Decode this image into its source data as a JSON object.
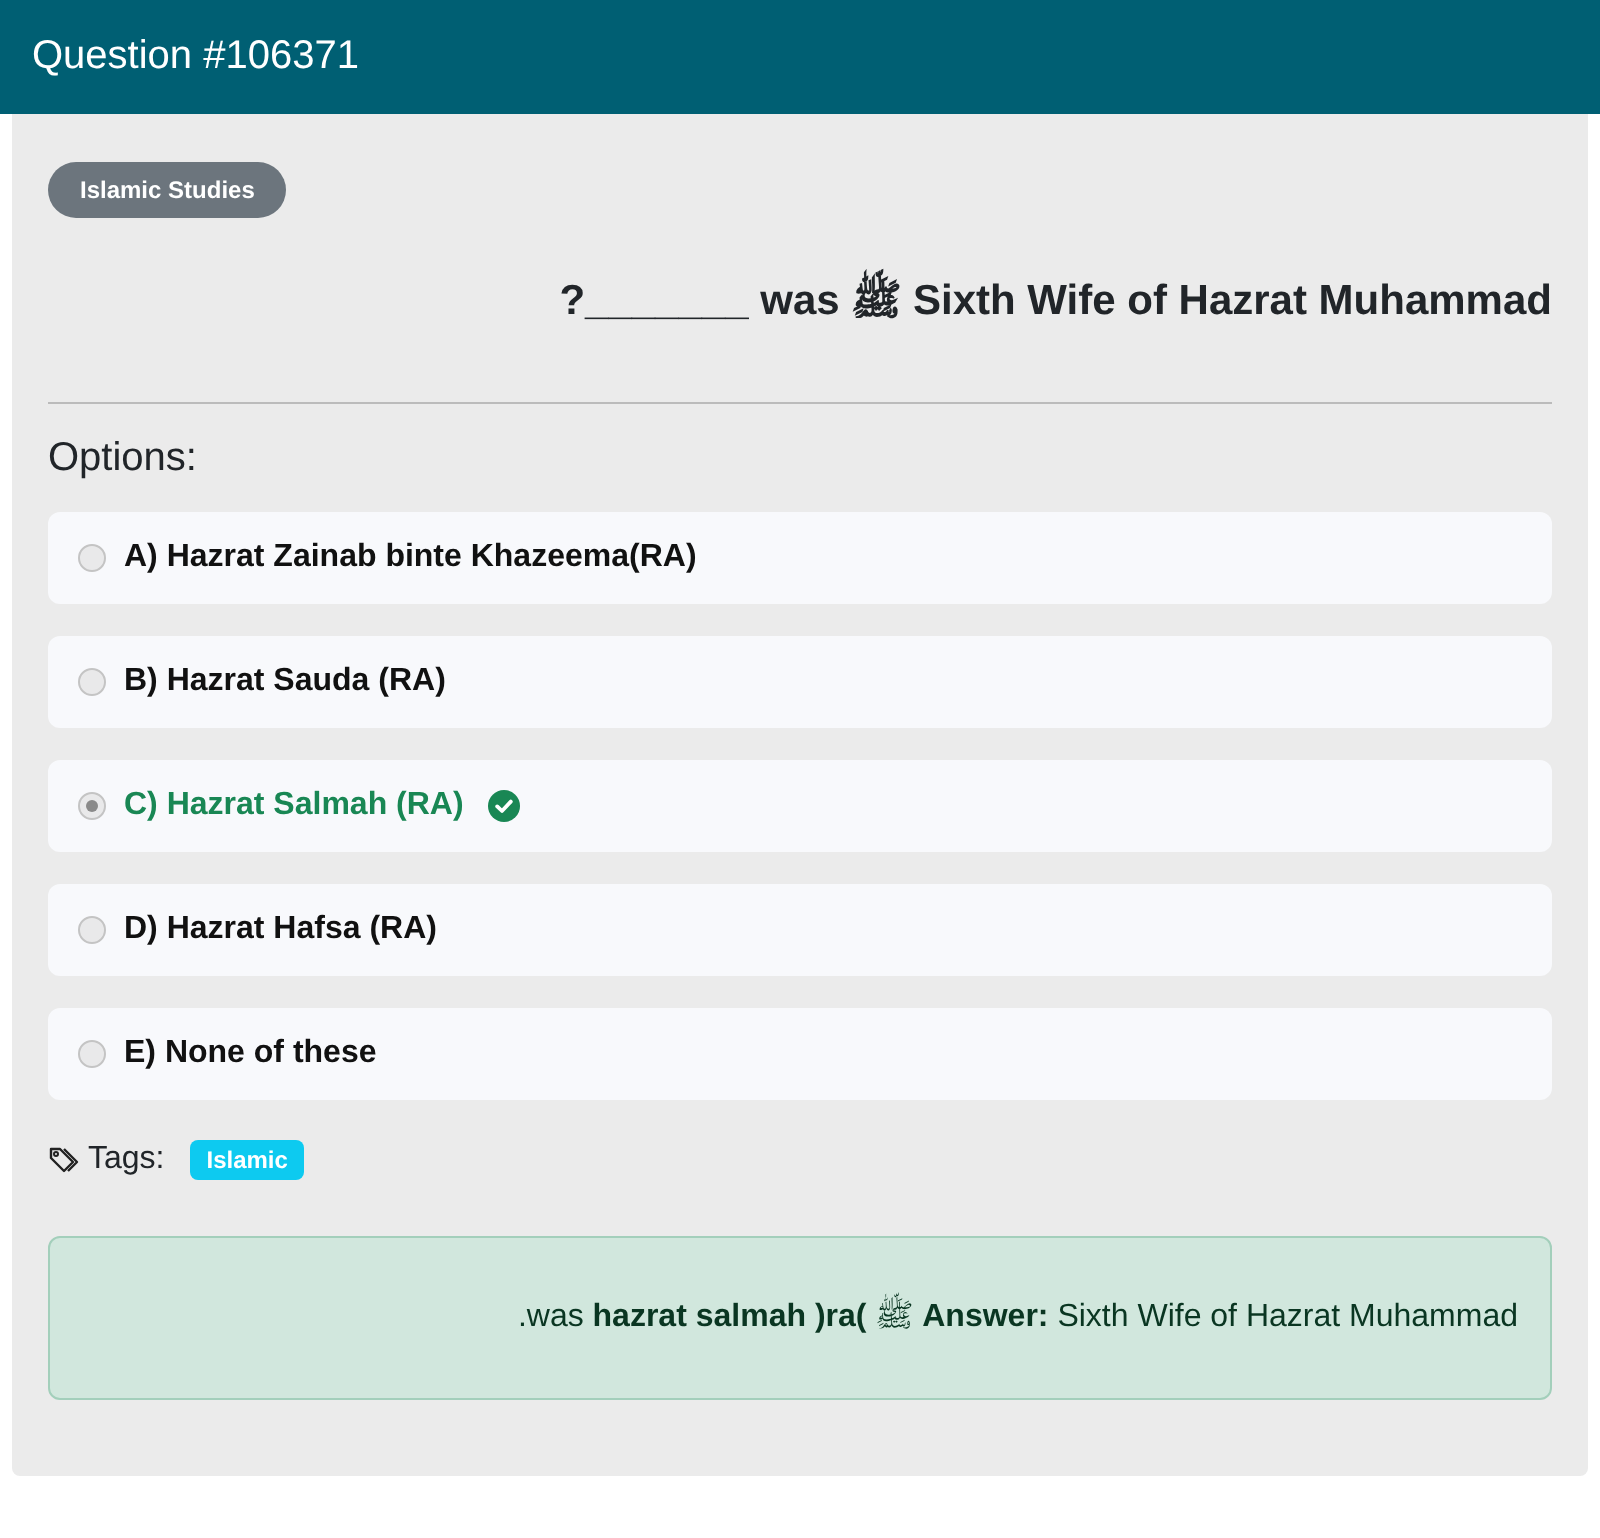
{
  "header": {
    "title": "Question #106371"
  },
  "category": "Islamic Studies",
  "question": "?_______ was ﷺ Sixth Wife of Hazrat Muhammad",
  "options_label": "Options:",
  "options": [
    {
      "label": "A) Hazrat Zainab binte Khazeema(RA)",
      "selected": false,
      "correct": false
    },
    {
      "label": "B) Hazrat Sauda (RA)",
      "selected": false,
      "correct": false
    },
    {
      "label": "C) Hazrat Salmah (RA)",
      "selected": true,
      "correct": true
    },
    {
      "label": "D) Hazrat Hafsa (RA)",
      "selected": false,
      "correct": false
    },
    {
      "label": "E) None of these",
      "selected": false,
      "correct": false
    }
  ],
  "tags_label": "Tags:",
  "tags": [
    "Islamic"
  ],
  "answer": ".was **hazrat salmah )ra(** ﷺ **Answer:** Sixth Wife of Hazrat Muhammad"
}
